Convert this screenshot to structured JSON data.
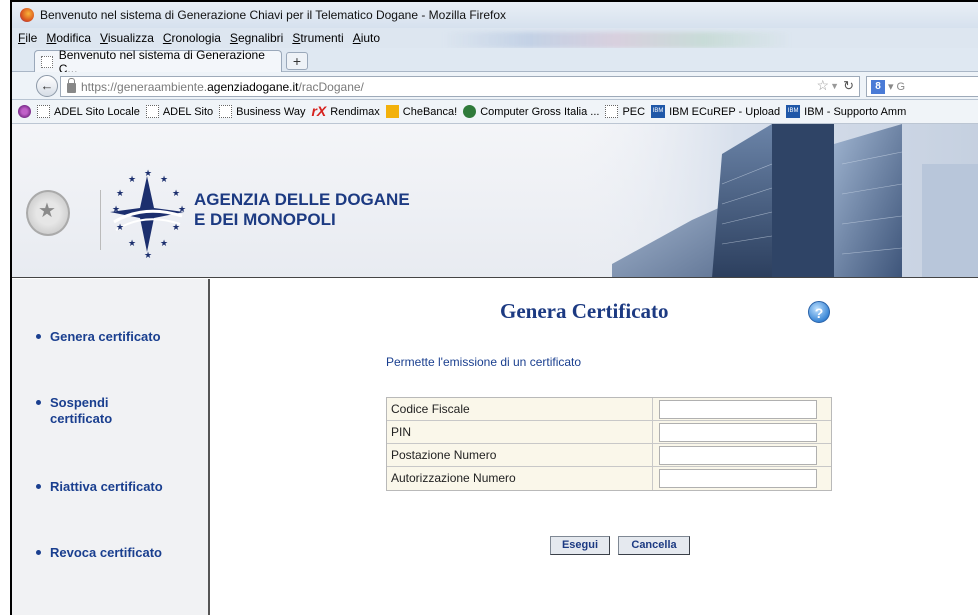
{
  "window": {
    "title": "Benvenuto nel sistema di Generazione Chiavi per il Telematico Dogane - Mozilla Firefox"
  },
  "menu": [
    "File",
    "Modifica",
    "Visualizza",
    "Cronologia",
    "Segnalibri",
    "Strumenti",
    "Aiuto"
  ],
  "tab": {
    "label": "Benvenuto nel sistema di Generazione C...",
    "new_tab": "+"
  },
  "nav": {
    "url_prefix": "https://generaambiente.",
    "url_domain": "agenziadogane.it",
    "url_path": "/racDogane/",
    "search_text": "G"
  },
  "bookmarks": [
    {
      "label": "ADEL Sito Locale",
      "icon": "blank-page-icon"
    },
    {
      "label": "ADEL Sito",
      "icon": "blank-page-icon"
    },
    {
      "label": "Business Way",
      "icon": "blank-page-icon"
    },
    {
      "label": "Rendimax",
      "icon": "rendimax-icon"
    },
    {
      "label": "CheBanca!",
      "icon": "chebanca-icon"
    },
    {
      "label": "Computer Gross Italia ...",
      "icon": "computer-gross-icon"
    },
    {
      "label": "PEC",
      "icon": "blank-page-icon"
    },
    {
      "label": "IBM ECuREP - Upload",
      "icon": "ibm-icon"
    },
    {
      "label": "IBM - Supporto Amm",
      "icon": "ibm-icon"
    }
  ],
  "header": {
    "agency_line1": "AGENZIA DELLE DOGANE",
    "agency_line2": "E DEI MONOPOLI"
  },
  "sidebar": {
    "items": [
      {
        "label": "Genera certificato"
      },
      {
        "label": "Sospendi certificato"
      },
      {
        "label": "Riattiva certificato"
      },
      {
        "label": "Revoca certificato"
      }
    ]
  },
  "main": {
    "title": "Genera Certificato",
    "help": "?",
    "subtitle": "Permette l'emissione di un certificato",
    "fields": [
      {
        "label": "Codice Fiscale",
        "value": ""
      },
      {
        "label": "PIN",
        "value": ""
      },
      {
        "label": "Postazione Numero",
        "value": ""
      },
      {
        "label": "Autorizzazione Numero",
        "value": ""
      }
    ],
    "execute_label": "Esegui",
    "cancel_label": "Cancella"
  },
  "colors": {
    "brand_blue": "#1c3a82",
    "form_bg": "#faf7ea"
  }
}
